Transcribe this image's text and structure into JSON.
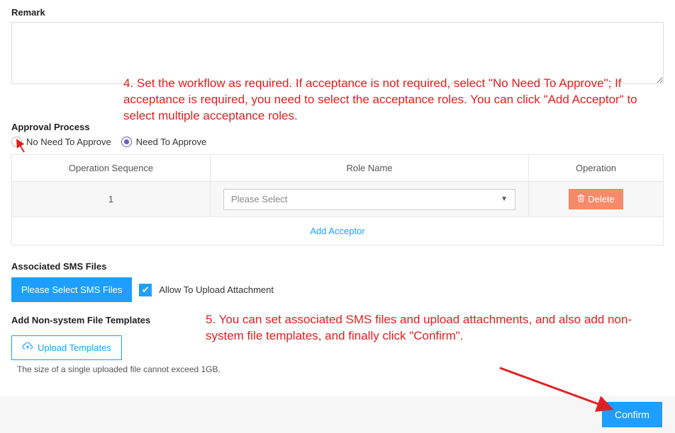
{
  "remark": {
    "label": "Remark",
    "value": ""
  },
  "annotation4": "4. Set the workflow as required. If acceptance is not required, select \"No Need To Approve\"; If acceptance is required, you need to select the acceptance roles. You can click \"Add Acceptor\" to select multiple acceptance roles.",
  "annotation5": "5. You can set associated SMS files and upload attachments, and also add non-system file templates, and finally click \"Confirm\".",
  "approval": {
    "label": "Approval Process",
    "options": {
      "no_need": "No Need To Approve",
      "need": "Need To Approve"
    },
    "selected": "need",
    "headers": {
      "seq": "Operation Sequence",
      "role": "Role Name",
      "op": "Operation"
    },
    "rows": [
      {
        "seq": "1",
        "role_placeholder": "Please Select",
        "delete_label": "Delete"
      }
    ],
    "add_label": "Add Acceptor"
  },
  "sms": {
    "label": "Associated SMS Files",
    "button": "Please Select SMS Files",
    "checkbox_label": "Allow To Upload Attachment",
    "checkbox_checked": true
  },
  "nonsys": {
    "label": "Add Non-system File Templates",
    "upload_button": "Upload Templates",
    "note": "The size of a single uploaded file cannot exceed 1GB."
  },
  "footer": {
    "confirm": "Confirm"
  }
}
